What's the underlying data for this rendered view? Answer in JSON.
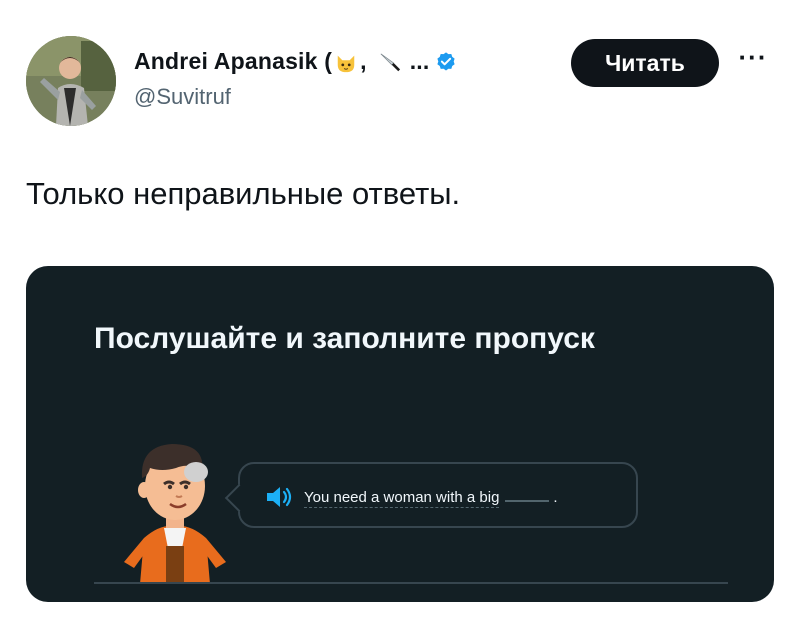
{
  "post": {
    "author": {
      "name_start": "Andrei Apanasik (",
      "name_sep": ",",
      "name_end": "...",
      "handle": "@Suvitruf",
      "emojis": [
        "cat-face-icon",
        "kitchen-knife-icon"
      ],
      "verified": true
    },
    "follow_label": "Читать",
    "more_label": "···",
    "text": "Только неправильные ответы."
  },
  "lesson_card": {
    "title": "Послушайте и заполните пропуск",
    "sentence": "You need a woman with a big",
    "sentence_end": ".",
    "colors": {
      "background": "#131f24",
      "speaker": "#1cb0f6",
      "border": "#37464f"
    }
  },
  "colors": {
    "verified_badge": "#1d9bf0",
    "follow_button": "#0f1419"
  }
}
